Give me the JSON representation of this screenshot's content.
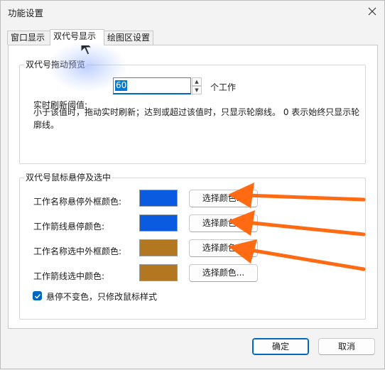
{
  "window": {
    "title": "功能设置"
  },
  "tabs": [
    {
      "label": "窗口显示",
      "active": false
    },
    {
      "label": "双代号显示",
      "active": true
    },
    {
      "label": "绘图区设置",
      "active": false
    }
  ],
  "drag_preview": {
    "group_title": "双代号拖动预览",
    "threshold_label": "实时刷新阈值:",
    "threshold_value": "60",
    "unit": "个工作",
    "description": "小于该值时，拖动实时刷新；达到或超过该值时，只显示轮廓线。 0 表示始终只显示轮廓线。"
  },
  "hover_select": {
    "group_title": "双代号鼠标悬停及选中",
    "rows": [
      {
        "label": "工作名称悬停外框颜色:",
        "color": "#0a5be0",
        "button": "选择颜色..."
      },
      {
        "label": "工作箭线悬停颜色:",
        "color": "#0a5be0",
        "button": "选择颜色..."
      },
      {
        "label": "工作名称选中外框颜色:",
        "color": "#b27720",
        "button": "选择颜色..."
      },
      {
        "label": "工作箭线选中颜色:",
        "color": "#b27720",
        "button": "选择颜色..."
      }
    ],
    "checkbox": {
      "label": "悬停不变色，只修改鼠标样式",
      "checked": true
    }
  },
  "footer": {
    "ok_label": "确定",
    "cancel_label": "取消"
  },
  "icons": {
    "close": "close-icon",
    "spin_up": "spin-up-icon",
    "spin_down": "spin-down-icon",
    "checkmark": "checkmark-icon",
    "cursor": "mouse-cursor-icon",
    "annotation_arrow": "orange-arrow-icon"
  },
  "colors": {
    "accent": "#0067c0",
    "annotation": "#ff6a13"
  }
}
